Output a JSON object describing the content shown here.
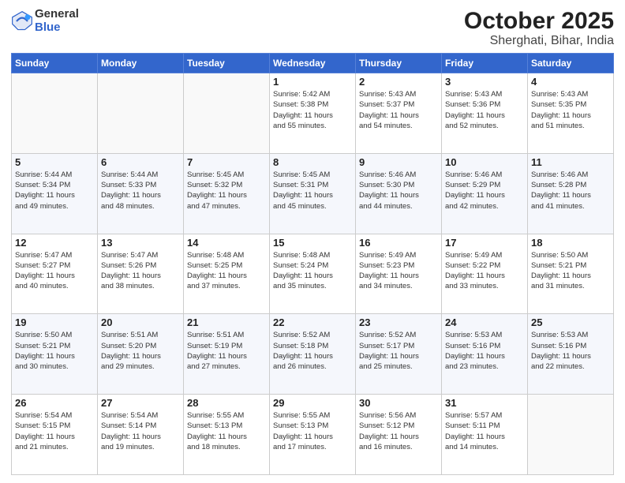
{
  "header": {
    "logo_general": "General",
    "logo_blue": "Blue",
    "title": "October 2025",
    "subtitle": "Sherghati, Bihar, India"
  },
  "calendar": {
    "days_of_week": [
      "Sunday",
      "Monday",
      "Tuesday",
      "Wednesday",
      "Thursday",
      "Friday",
      "Saturday"
    ],
    "weeks": [
      [
        {
          "day": "",
          "info": ""
        },
        {
          "day": "",
          "info": ""
        },
        {
          "day": "",
          "info": ""
        },
        {
          "day": "1",
          "info": "Sunrise: 5:42 AM\nSunset: 5:38 PM\nDaylight: 11 hours\nand 55 minutes."
        },
        {
          "day": "2",
          "info": "Sunrise: 5:43 AM\nSunset: 5:37 PM\nDaylight: 11 hours\nand 54 minutes."
        },
        {
          "day": "3",
          "info": "Sunrise: 5:43 AM\nSunset: 5:36 PM\nDaylight: 11 hours\nand 52 minutes."
        },
        {
          "day": "4",
          "info": "Sunrise: 5:43 AM\nSunset: 5:35 PM\nDaylight: 11 hours\nand 51 minutes."
        }
      ],
      [
        {
          "day": "5",
          "info": "Sunrise: 5:44 AM\nSunset: 5:34 PM\nDaylight: 11 hours\nand 49 minutes."
        },
        {
          "day": "6",
          "info": "Sunrise: 5:44 AM\nSunset: 5:33 PM\nDaylight: 11 hours\nand 48 minutes."
        },
        {
          "day": "7",
          "info": "Sunrise: 5:45 AM\nSunset: 5:32 PM\nDaylight: 11 hours\nand 47 minutes."
        },
        {
          "day": "8",
          "info": "Sunrise: 5:45 AM\nSunset: 5:31 PM\nDaylight: 11 hours\nand 45 minutes."
        },
        {
          "day": "9",
          "info": "Sunrise: 5:46 AM\nSunset: 5:30 PM\nDaylight: 11 hours\nand 44 minutes."
        },
        {
          "day": "10",
          "info": "Sunrise: 5:46 AM\nSunset: 5:29 PM\nDaylight: 11 hours\nand 42 minutes."
        },
        {
          "day": "11",
          "info": "Sunrise: 5:46 AM\nSunset: 5:28 PM\nDaylight: 11 hours\nand 41 minutes."
        }
      ],
      [
        {
          "day": "12",
          "info": "Sunrise: 5:47 AM\nSunset: 5:27 PM\nDaylight: 11 hours\nand 40 minutes."
        },
        {
          "day": "13",
          "info": "Sunrise: 5:47 AM\nSunset: 5:26 PM\nDaylight: 11 hours\nand 38 minutes."
        },
        {
          "day": "14",
          "info": "Sunrise: 5:48 AM\nSunset: 5:25 PM\nDaylight: 11 hours\nand 37 minutes."
        },
        {
          "day": "15",
          "info": "Sunrise: 5:48 AM\nSunset: 5:24 PM\nDaylight: 11 hours\nand 35 minutes."
        },
        {
          "day": "16",
          "info": "Sunrise: 5:49 AM\nSunset: 5:23 PM\nDaylight: 11 hours\nand 34 minutes."
        },
        {
          "day": "17",
          "info": "Sunrise: 5:49 AM\nSunset: 5:22 PM\nDaylight: 11 hours\nand 33 minutes."
        },
        {
          "day": "18",
          "info": "Sunrise: 5:50 AM\nSunset: 5:21 PM\nDaylight: 11 hours\nand 31 minutes."
        }
      ],
      [
        {
          "day": "19",
          "info": "Sunrise: 5:50 AM\nSunset: 5:21 PM\nDaylight: 11 hours\nand 30 minutes."
        },
        {
          "day": "20",
          "info": "Sunrise: 5:51 AM\nSunset: 5:20 PM\nDaylight: 11 hours\nand 29 minutes."
        },
        {
          "day": "21",
          "info": "Sunrise: 5:51 AM\nSunset: 5:19 PM\nDaylight: 11 hours\nand 27 minutes."
        },
        {
          "day": "22",
          "info": "Sunrise: 5:52 AM\nSunset: 5:18 PM\nDaylight: 11 hours\nand 26 minutes."
        },
        {
          "day": "23",
          "info": "Sunrise: 5:52 AM\nSunset: 5:17 PM\nDaylight: 11 hours\nand 25 minutes."
        },
        {
          "day": "24",
          "info": "Sunrise: 5:53 AM\nSunset: 5:16 PM\nDaylight: 11 hours\nand 23 minutes."
        },
        {
          "day": "25",
          "info": "Sunrise: 5:53 AM\nSunset: 5:16 PM\nDaylight: 11 hours\nand 22 minutes."
        }
      ],
      [
        {
          "day": "26",
          "info": "Sunrise: 5:54 AM\nSunset: 5:15 PM\nDaylight: 11 hours\nand 21 minutes."
        },
        {
          "day": "27",
          "info": "Sunrise: 5:54 AM\nSunset: 5:14 PM\nDaylight: 11 hours\nand 19 minutes."
        },
        {
          "day": "28",
          "info": "Sunrise: 5:55 AM\nSunset: 5:13 PM\nDaylight: 11 hours\nand 18 minutes."
        },
        {
          "day": "29",
          "info": "Sunrise: 5:55 AM\nSunset: 5:13 PM\nDaylight: 11 hours\nand 17 minutes."
        },
        {
          "day": "30",
          "info": "Sunrise: 5:56 AM\nSunset: 5:12 PM\nDaylight: 11 hours\nand 16 minutes."
        },
        {
          "day": "31",
          "info": "Sunrise: 5:57 AM\nSunset: 5:11 PM\nDaylight: 11 hours\nand 14 minutes."
        },
        {
          "day": "",
          "info": ""
        }
      ]
    ]
  }
}
